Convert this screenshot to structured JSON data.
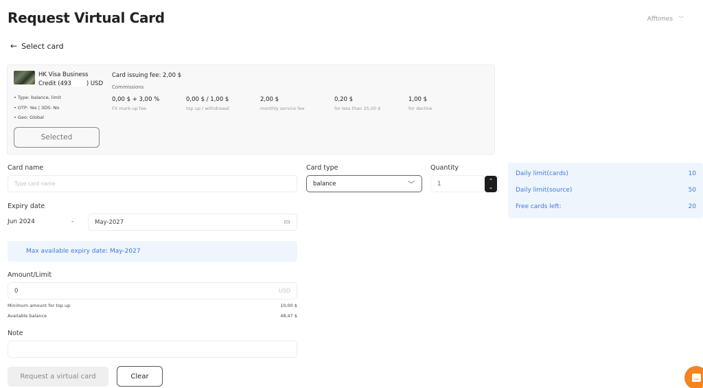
{
  "page": {
    "title": "Request Virtual Card",
    "user_menu": {
      "label": "Afftimes",
      "icon": "chevron-down-icon"
    },
    "back_link": {
      "icon": "arrow-left-icon",
      "label": "Select card"
    }
  },
  "card": {
    "name_line1": "HK Visa Business",
    "name_line2_prefix": "Credit (493",
    "name_line2_suffix": ") USD",
    "features": [
      "• Type: balance, limit",
      "• OTP: Yes | 3DS: No",
      "• Geo: Global"
    ],
    "selected_label": "Selected",
    "issuing_fee": "Card issuing fee: 2,00 $",
    "commissions_label": "Commissions",
    "commissions": [
      {
        "value": "0,00 $ + 3,00 %",
        "label": "FX mark-up fee"
      },
      {
        "value": "0,00 $ / 1,00 $",
        "label": "top up / withdrawal"
      },
      {
        "value": "2,00 $",
        "label": "monthly service fee"
      },
      {
        "value": "0,20 $",
        "label": "for less than 25,00 $"
      },
      {
        "value": "1,00 $",
        "label": "for decline"
      }
    ]
  },
  "form": {
    "card_name": {
      "label": "Card name",
      "placeholder": "Type card name",
      "value": ""
    },
    "card_type": {
      "label": "Card type",
      "selected": "balance"
    },
    "quantity": {
      "label": "Quantity",
      "value": "1",
      "up": "⌃",
      "down": "⌄"
    },
    "expiry": {
      "label": "Expiry date",
      "start": "Jun 2024",
      "dash": "-",
      "end": "May-2027"
    },
    "expiry_info": "Max available expiry date: May-2027",
    "amount": {
      "label": "Amount/Limit",
      "value": "0",
      "currency": "USD"
    },
    "min_amount": {
      "label": "Minimum amount  for top up",
      "value": "10,00 $"
    },
    "available_balance": {
      "label": "Available balance",
      "value": "48,47 $"
    },
    "note": {
      "label": "Note",
      "value": ""
    },
    "request_button": "Request a virtual card",
    "clear_button": "Clear"
  },
  "limits": [
    {
      "label": "Daily limit(cards)",
      "value": "10"
    },
    {
      "label": "Daily limit(source)",
      "value": "50"
    },
    {
      "label": "Free cards left:",
      "value": "20"
    }
  ],
  "colors": {
    "accent_blue": "#3f7ad8",
    "info_bg": "#eef5fd",
    "chat_orange": "#f5831f"
  }
}
